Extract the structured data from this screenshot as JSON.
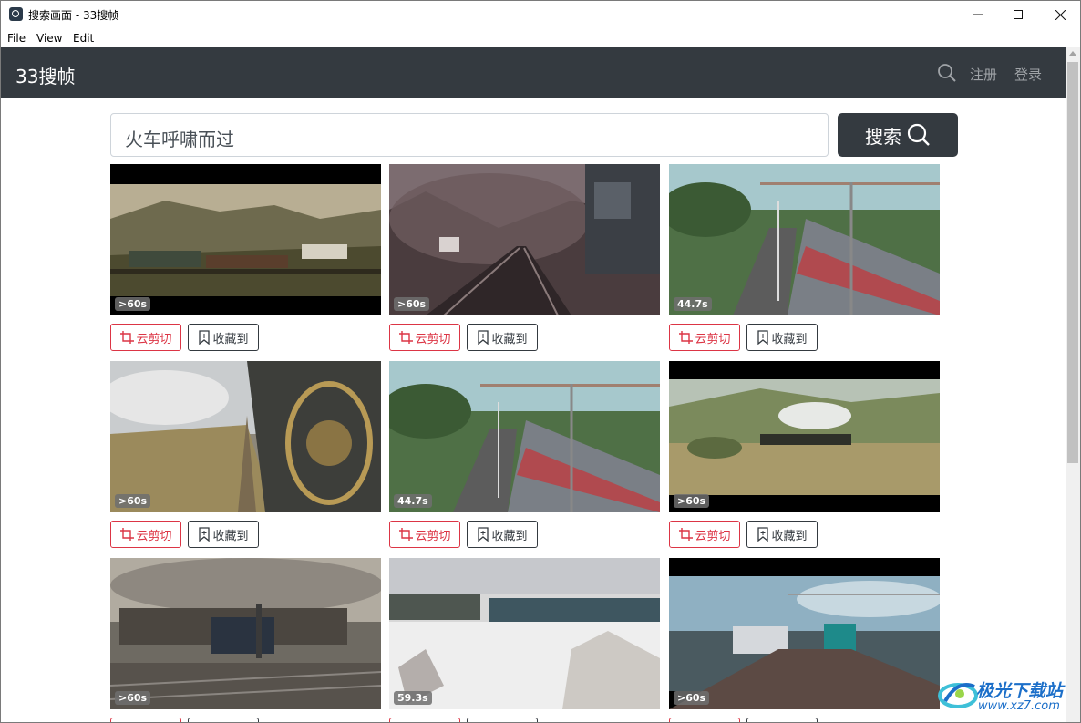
{
  "window": {
    "title": "搜索画面 - 33搜帧"
  },
  "menu": {
    "items": [
      "File",
      "View",
      "Edit"
    ]
  },
  "navbar": {
    "brand": "33搜帧",
    "register": "注册",
    "login": "登录"
  },
  "search": {
    "value": "火车呼啸而过",
    "button_label": "搜索"
  },
  "buttons": {
    "cut_label": "云剪切",
    "fav_label": "收藏到"
  },
  "results": [
    {
      "duration": ">60s",
      "scene": "valley-freight-train"
    },
    {
      "duration": ">60s",
      "scene": "anime-foggy-tracks"
    },
    {
      "duration": "44.7s",
      "scene": "curved-platform-train"
    },
    {
      "duration": ">60s",
      "scene": "steam-locomotive-emblem"
    },
    {
      "duration": "44.7s",
      "scene": "curved-platform-train"
    },
    {
      "duration": ">60s",
      "scene": "steam-train-field"
    },
    {
      "duration": ">60s",
      "scene": "rail-yard-cloudy"
    },
    {
      "duration": "59.3s",
      "scene": "snowy-freight-cars"
    },
    {
      "duration": ">60s",
      "scene": "motion-blur-trains"
    }
  ],
  "watermark": {
    "name": "极光下载站",
    "url": "www.xz7.com"
  }
}
